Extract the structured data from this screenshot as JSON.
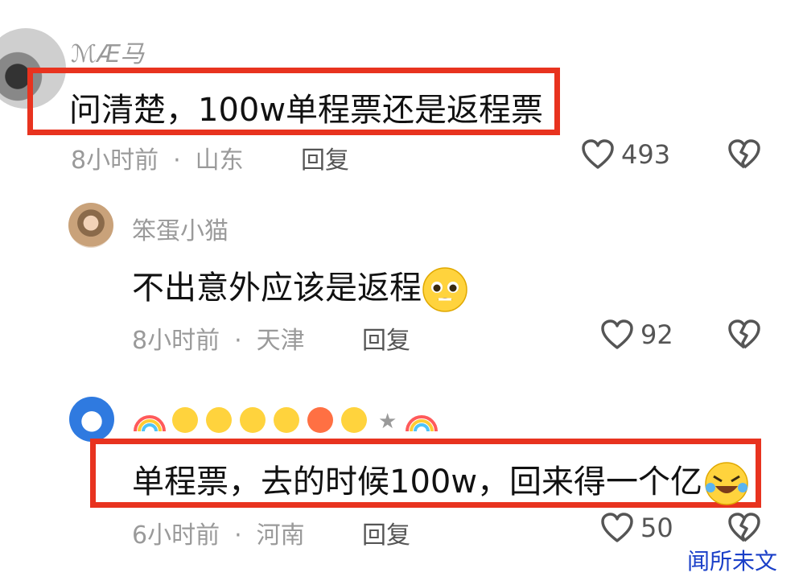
{
  "comments": [
    {
      "username": "ℳÆ马",
      "text": "问清楚，100w单程票还是返程票",
      "time": "8小时前",
      "location": "山东",
      "reply_label": "回复",
      "likes": "493"
    },
    {
      "username": "笨蛋小猫",
      "text": "不出意外应该是返程",
      "emoji": "pleading-face-emoji",
      "time": "8小时前",
      "location": "天津",
      "reply_label": "回复",
      "likes": "92"
    },
    {
      "username": "★",
      "username_decor": [
        "rainbow-emoji",
        "sad-face-emoji",
        "crying-face-emoji",
        "frowning-face-emoji",
        "sleepy-face-emoji",
        "angry-face-emoji",
        "grinning-sweat-emoji",
        "star",
        "rainbow-emoji"
      ],
      "text": "单程票，去的时候100w，回来得一个亿",
      "emoji": "rolling-laughing-emoji",
      "time": "6小时前",
      "location": "河南",
      "reply_label": "回复",
      "likes": "50"
    }
  ],
  "separator": "·",
  "watermark": "闻所未文",
  "colors": {
    "highlight": "#e8331f",
    "meta": "#9a9a9a",
    "watermark": "#1a3fc8"
  }
}
